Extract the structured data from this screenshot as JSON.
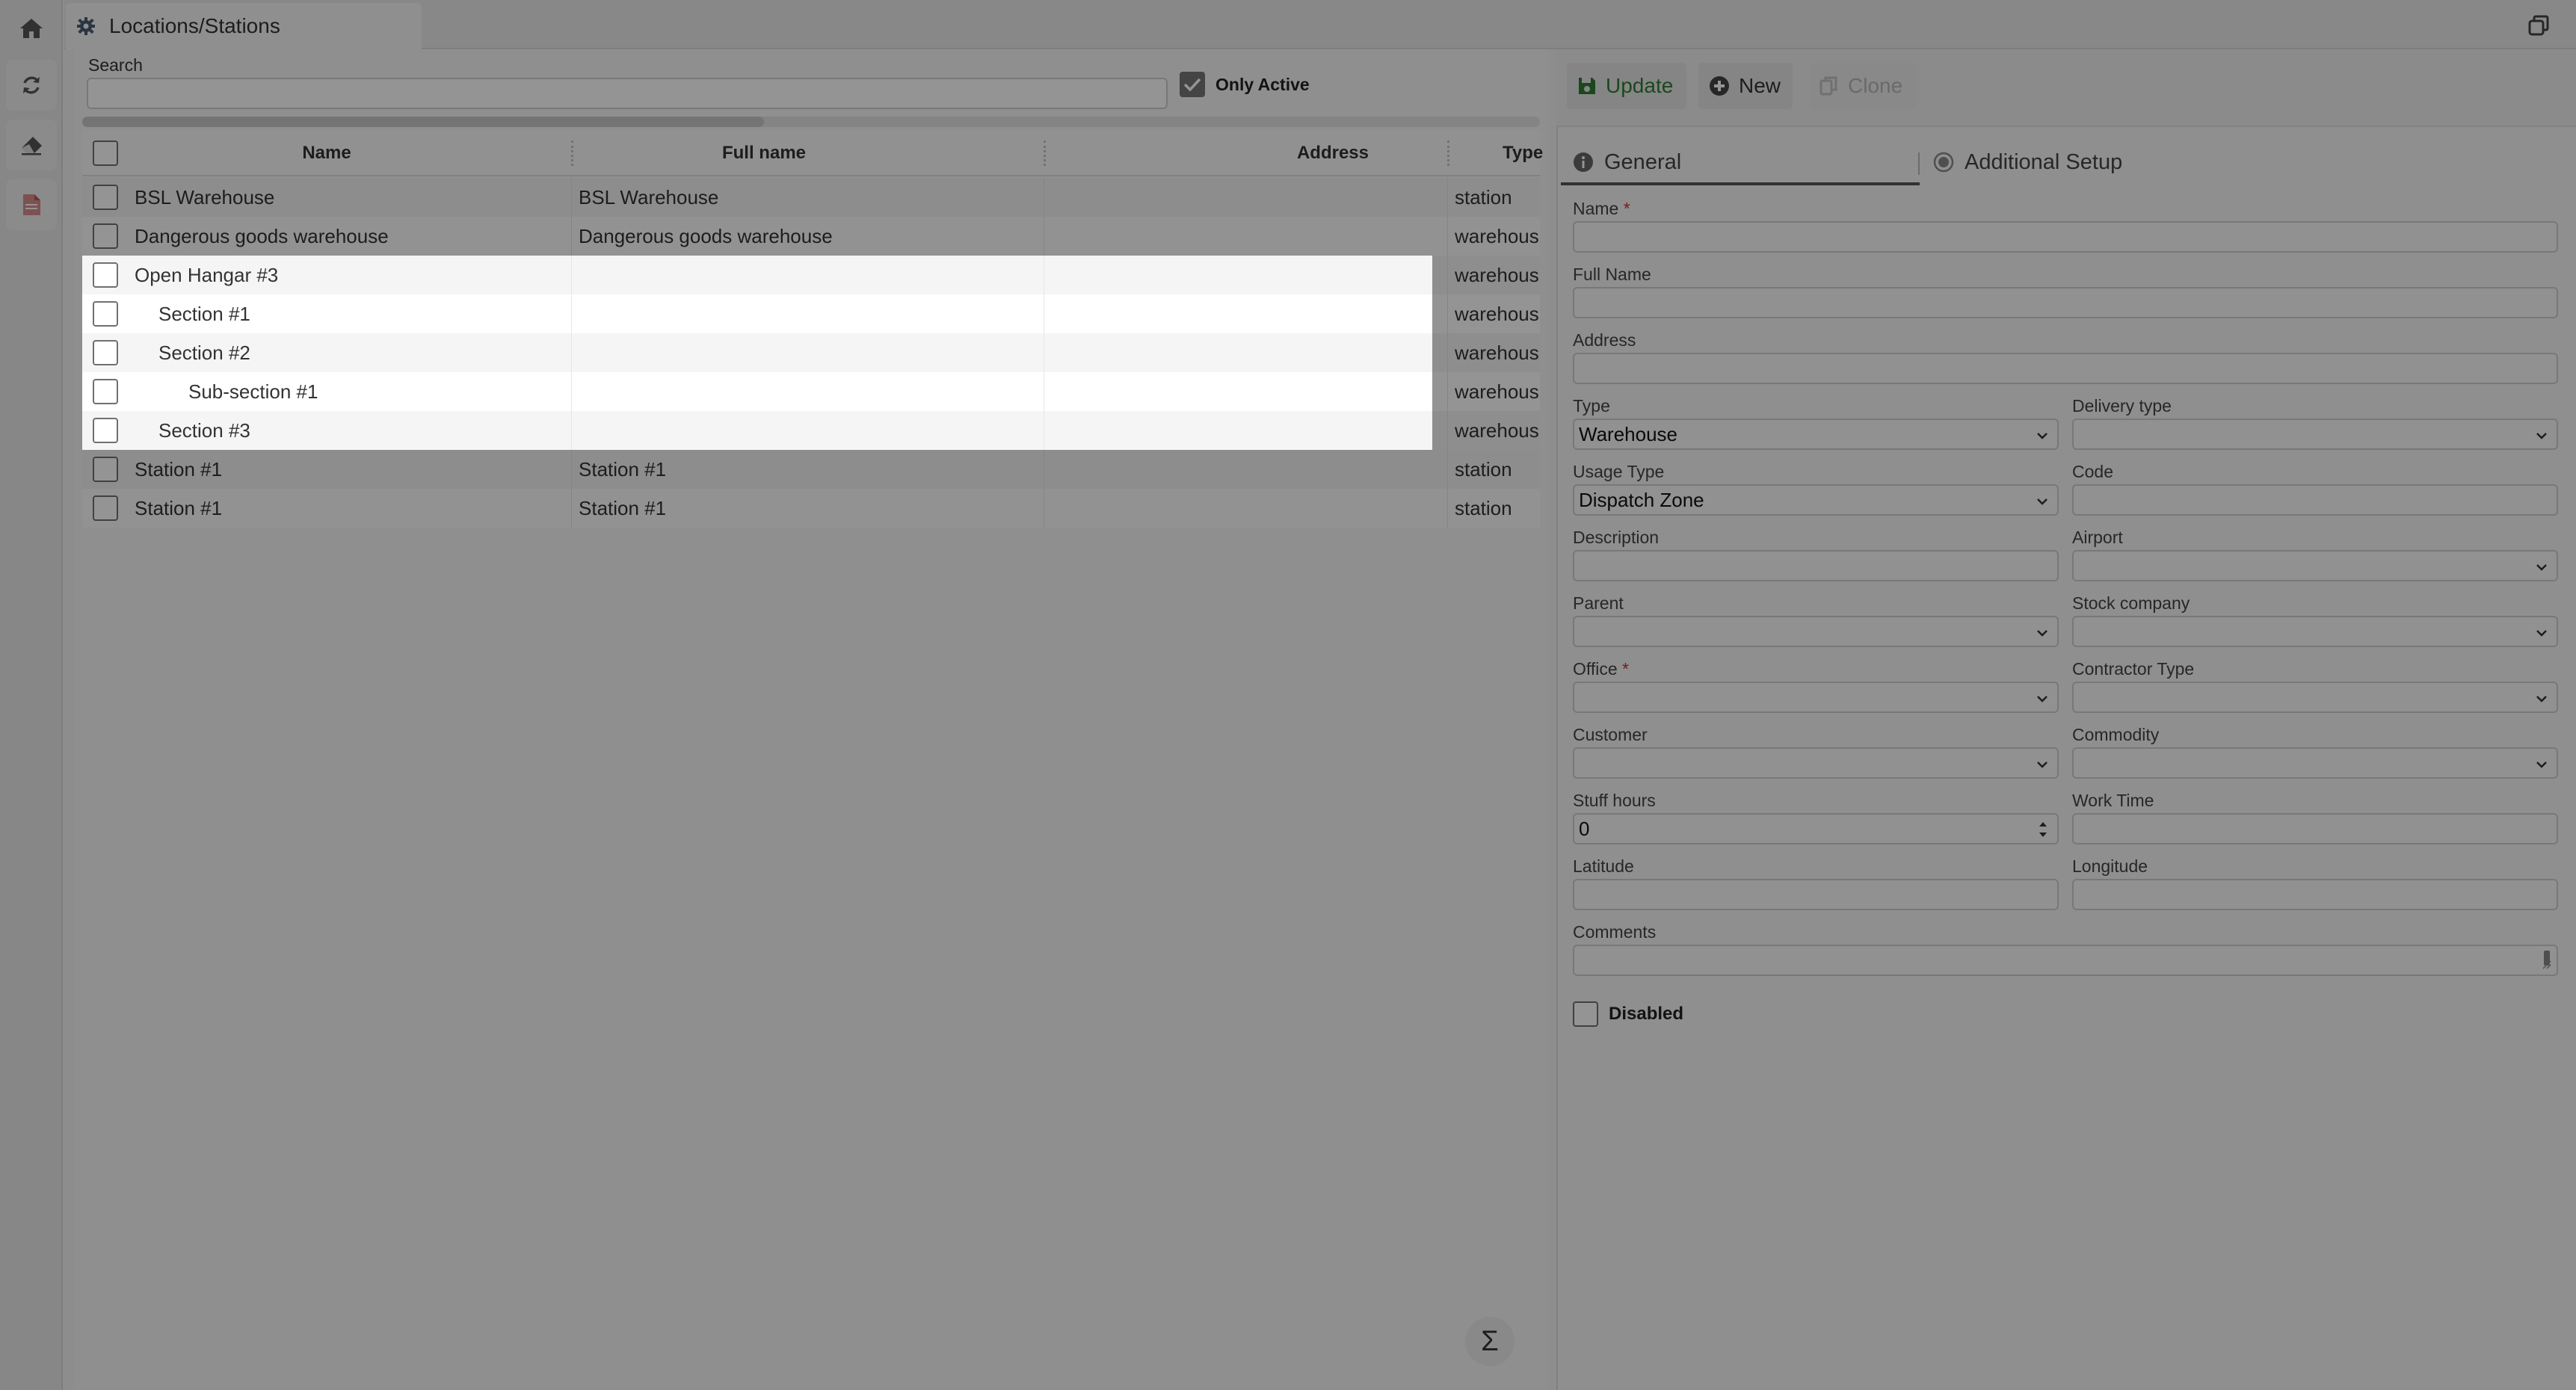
{
  "rail": {
    "items": [
      {
        "name": "home",
        "icon": "home-icon"
      },
      {
        "name": "refresh",
        "icon": "refresh-icon"
      },
      {
        "name": "clear",
        "icon": "eraser-icon"
      },
      {
        "name": "pdf",
        "icon": "pdf-icon"
      }
    ]
  },
  "window": {
    "tab_title": "Locations/Stations"
  },
  "search": {
    "label": "Search",
    "value": ""
  },
  "filter": {
    "only_active_label": "Only Active",
    "only_active_checked": true
  },
  "grid": {
    "columns": [
      "Name",
      "Full name",
      "Address",
      "Type"
    ],
    "rows": [
      {
        "name": "BSL Warehouse",
        "full_name": "BSL Warehouse",
        "address": "",
        "type": "station",
        "indent": 0
      },
      {
        "name": "Dangerous goods warehouse",
        "full_name": "Dangerous goods warehouse",
        "address": "",
        "type": "warehous",
        "indent": 0
      },
      {
        "name": "Open Hangar #3",
        "full_name": "",
        "address": "",
        "type": "warehous",
        "indent": 0
      },
      {
        "name": "Section #1",
        "full_name": "",
        "address": "",
        "type": "warehous",
        "indent": 1
      },
      {
        "name": "Section #2",
        "full_name": "",
        "address": "",
        "type": "warehous",
        "indent": 1
      },
      {
        "name": "Sub-section #1",
        "full_name": "",
        "address": "",
        "type": "warehous",
        "indent": 2
      },
      {
        "name": "Section #3",
        "full_name": "",
        "address": "",
        "type": "warehous",
        "indent": 1
      },
      {
        "name": "Station #1",
        "full_name": "Station #1",
        "address": "",
        "type": "station",
        "indent": 0
      },
      {
        "name": "Station #1",
        "full_name": "Station #1",
        "address": "",
        "type": "station",
        "indent": 0
      }
    ],
    "totals_icon": "sigma-icon",
    "totals_label": "Σ"
  },
  "toolbar": {
    "update_label": "Update",
    "new_label": "New",
    "clone_label": "Clone"
  },
  "tabs": {
    "general": "General",
    "additional": "Additional Setup"
  },
  "form": {
    "name_label": "Name",
    "name_value": "",
    "full_name_label": "Full Name",
    "full_name_value": "",
    "address_label": "Address",
    "address_value": "",
    "type_label": "Type",
    "type_value": "Warehouse",
    "delivery_type_label": "Delivery type",
    "delivery_type_value": "",
    "usage_type_label": "Usage Type",
    "usage_type_value": "Dispatch Zone",
    "code_label": "Code",
    "code_value": "",
    "description_label": "Description",
    "description_value": "",
    "airport_label": "Airport",
    "airport_value": "",
    "parent_label": "Parent",
    "parent_value": "",
    "stock_company_label": "Stock company",
    "stock_company_value": "",
    "office_label": "Office",
    "office_value": "",
    "contractor_type_label": "Contractor Type",
    "contractor_type_value": "",
    "customer_label": "Customer",
    "customer_value": "",
    "commodity_label": "Commodity",
    "commodity_value": "",
    "stuff_hours_label": "Stuff hours",
    "stuff_hours_value": "0",
    "work_time_label": "Work Time",
    "work_time_value": "",
    "latitude_label": "Latitude",
    "latitude_value": "",
    "longitude_label": "Longitude",
    "longitude_value": "",
    "comments_label": "Comments",
    "comments_value": "",
    "disabled_label": "Disabled",
    "disabled_checked": false,
    "required_mark": "*"
  },
  "colors": {
    "accent_green": "#2e7d32",
    "required_red": "#d32f2f",
    "dim_overlay": "rgba(0,0,0,0.4)"
  }
}
